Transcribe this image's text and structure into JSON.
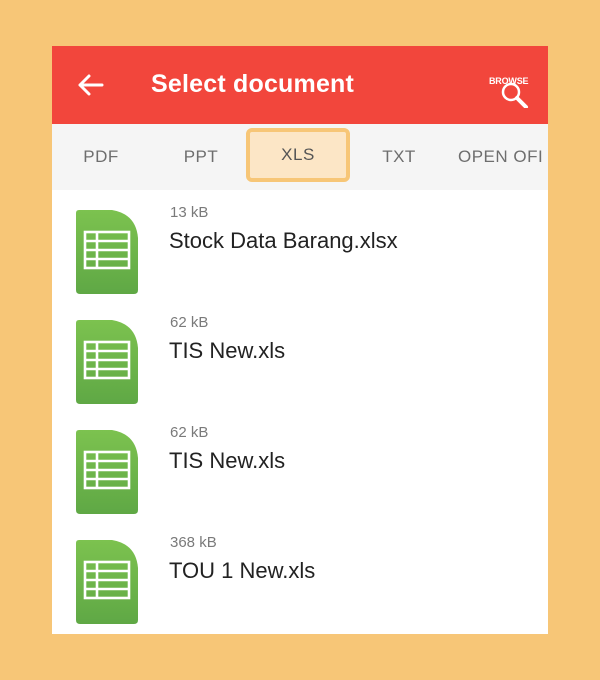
{
  "appbar": {
    "title": "Select document",
    "browse_label": "BROWSE",
    "back_icon": "arrow-left-icon",
    "browse_icon": "magnifier-icon",
    "color": "#F2463C"
  },
  "tabs": [
    {
      "label": "PDF",
      "selected": false
    },
    {
      "label": "PPT",
      "selected": false
    },
    {
      "label": "XLS",
      "selected": true
    },
    {
      "label": "TXT",
      "selected": false
    },
    {
      "label": "OPEN OFI",
      "selected": false
    }
  ],
  "files": [
    {
      "size": "13 kB",
      "name": "Stock Data Barang.xlsx",
      "icon": "spreadsheet-icon"
    },
    {
      "size": "62 kB",
      "name": "TIS New.xls",
      "icon": "spreadsheet-icon"
    },
    {
      "size": "62 kB",
      "name": "TIS New.xls",
      "icon": "spreadsheet-icon"
    },
    {
      "size": "368 kB",
      "name": "TOU 1 New.xls",
      "icon": "spreadsheet-icon"
    }
  ],
  "colors": {
    "background": "#F7C677",
    "highlight": "#FCE6C6",
    "file_icon_green": "#6DB84B"
  }
}
